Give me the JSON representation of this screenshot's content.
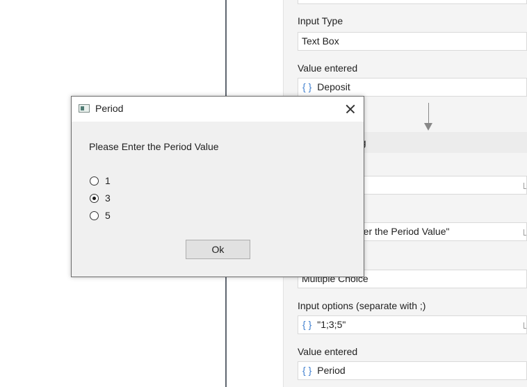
{
  "properties": {
    "input_type_label": "Input Type",
    "input_type_value": "Text Box",
    "value_entered_label_1": "Value entered",
    "value_entered_value_1": "Deposit",
    "braces_symbol": "{ }",
    "sequence_title_partial": "og",
    "prompt_partial": "nter the Period Value\"",
    "input_type_value_2": "Multiple Choice",
    "input_options_label": "Input options (separate with ;)",
    "input_options_value": "\"1;3;5\"",
    "value_entered_label_2": "Value entered",
    "value_entered_value_2": "Period"
  },
  "dialog": {
    "title": "Period",
    "prompt": "Please Enter the Period Value",
    "options": [
      {
        "label": "1",
        "checked": false
      },
      {
        "label": "3",
        "checked": true
      },
      {
        "label": "5",
        "checked": false
      }
    ],
    "ok_label": "Ok"
  }
}
